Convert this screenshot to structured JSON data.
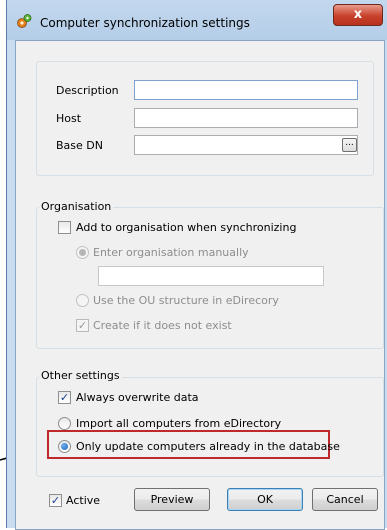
{
  "window": {
    "title": "Computer synchronization settings",
    "close_label": "x"
  },
  "connection": {
    "description_label": "Description",
    "host_label": "Host",
    "base_dn_label": "Base DN",
    "description_value": "",
    "host_value": "",
    "base_dn_value": "",
    "browse_label": "..."
  },
  "organisation": {
    "legend": "Organisation",
    "add_label": "Add to organisation when synchronizing",
    "add_checked": false,
    "manual_label": "Enter organisation manually",
    "manual_value": "",
    "ou_label": "Use the OU structure in eDirecory",
    "create_label": "Create if it does not exist"
  },
  "other_settings": {
    "legend": "Other settings",
    "overwrite_label": "Always overwrite data",
    "import_all_label": "Import all computers from eDirectory",
    "only_update_label": "Only update computers already in the database"
  },
  "footer": {
    "active_label": "Active",
    "preview_label": "Preview",
    "ok_label": "OK",
    "cancel_label": "Cancel"
  },
  "colors": {
    "highlight_box": "#c0292b",
    "annotation_arrow": "#000000"
  }
}
